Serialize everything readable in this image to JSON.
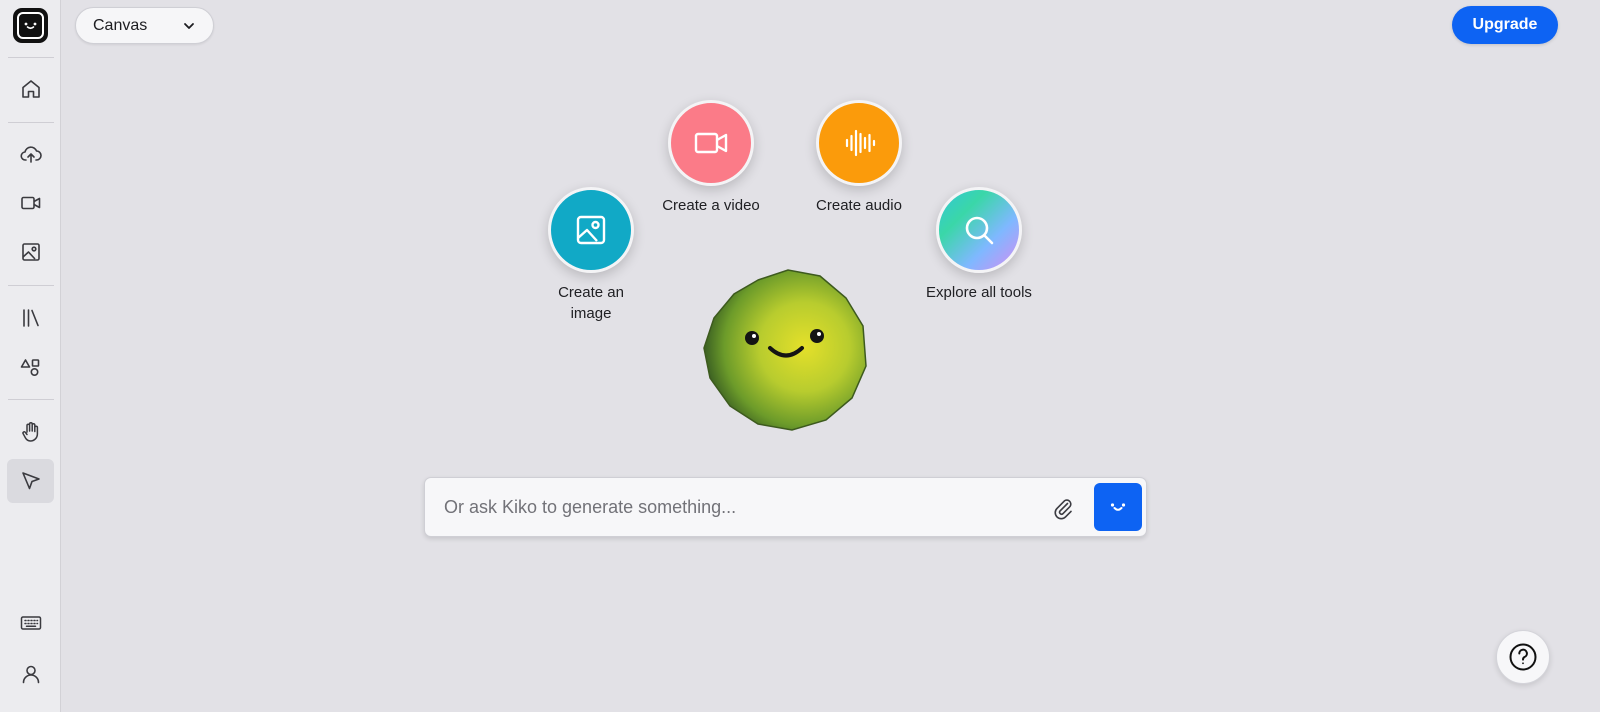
{
  "header": {
    "canvas_select_label": "Canvas",
    "upgrade_label": "Upgrade"
  },
  "sidebar": {
    "items": [
      {
        "name": "home",
        "icon": "home-icon"
      },
      {
        "name": "upload",
        "icon": "upload-cloud-icon"
      },
      {
        "name": "video",
        "icon": "video-icon"
      },
      {
        "name": "image",
        "icon": "image-icon"
      },
      {
        "name": "library",
        "icon": "library-icon"
      },
      {
        "name": "elements",
        "icon": "shapes-icon"
      },
      {
        "name": "hand-tool",
        "icon": "hand-icon"
      },
      {
        "name": "select-tool",
        "icon": "cursor-icon",
        "active": true
      },
      {
        "name": "keyboard-shortcuts",
        "icon": "keyboard-icon"
      },
      {
        "name": "account",
        "icon": "user-icon"
      }
    ]
  },
  "actions": [
    {
      "id": "create-image",
      "label": "Create an image",
      "icon": "image-icon",
      "color": "#11a9c6"
    },
    {
      "id": "create-video",
      "label": "Create a video",
      "icon": "video-icon",
      "color": "#fb7b88"
    },
    {
      "id": "create-audio",
      "label": "Create audio",
      "icon": "audio-wave-icon",
      "color": "#fb9b0b"
    },
    {
      "id": "explore-tools",
      "label": "Explore all tools",
      "icon": "search-icon",
      "color": "gradient"
    }
  ],
  "prompt": {
    "placeholder": "Or ask Kiko to generate something...",
    "value": ""
  },
  "help": {
    "label": "?"
  },
  "colors": {
    "accent": "#0d63f3",
    "background": "#e2e1e6"
  }
}
